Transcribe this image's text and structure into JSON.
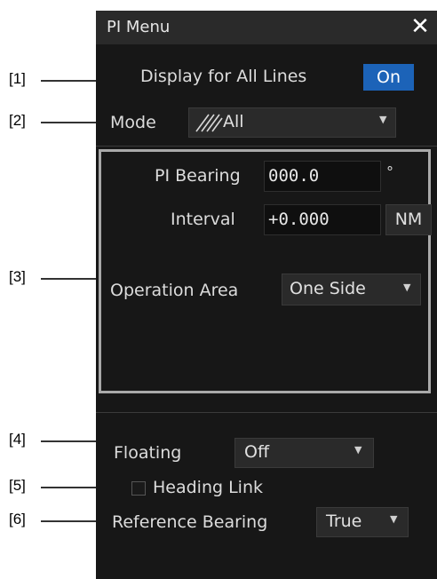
{
  "callouts": [
    "[1]",
    "[2]",
    "[3]",
    "[4]",
    "[5]",
    "[6]"
  ],
  "panel": {
    "title": "PI Menu",
    "close_glyph": "✕",
    "display_all_lines": {
      "label": "Display for All Lines",
      "button": "On"
    },
    "mode": {
      "label": "Mode",
      "icon": "hatch-icon",
      "value": "All"
    },
    "pi_bearing": {
      "label": "PI Bearing",
      "value": "000.0",
      "unit": "°"
    },
    "interval": {
      "label": "Interval",
      "value": "+0.000",
      "unit": "NM"
    },
    "operation_area": {
      "label": "Operation Area",
      "value": "One Side"
    },
    "floating": {
      "label": "Floating",
      "value": "Off"
    },
    "heading_link": {
      "label": "Heading Link",
      "checked": false
    },
    "reference_bearing": {
      "label": "Reference Bearing",
      "value": "True"
    }
  },
  "colors": {
    "panel_bg": "#171717",
    "accent": "#1c63b8",
    "frame": "#a9a9a9"
  }
}
